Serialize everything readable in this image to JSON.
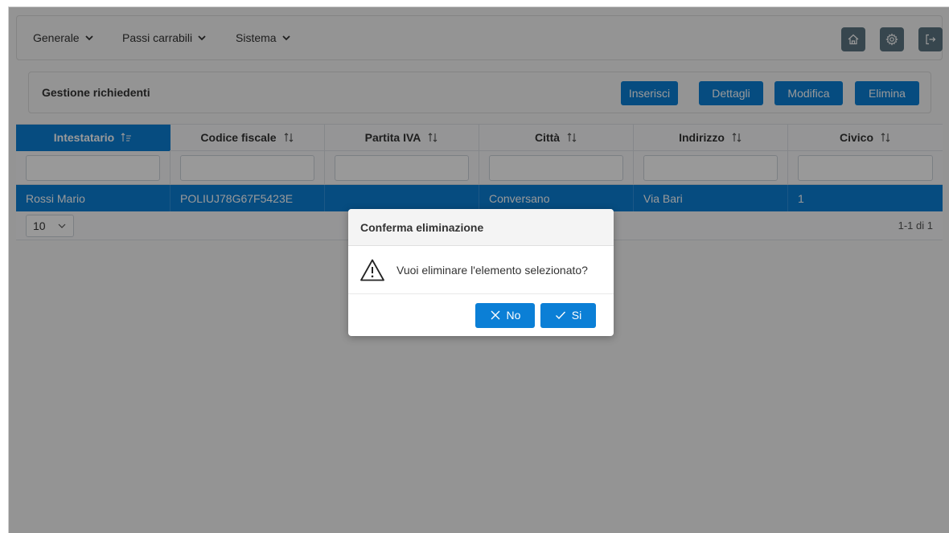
{
  "menubar": {
    "items": [
      {
        "label": "Generale"
      },
      {
        "label": "Passi carrabili"
      },
      {
        "label": "Sistema"
      }
    ],
    "icons": [
      "home-icon",
      "gear-icon",
      "logout-icon"
    ]
  },
  "toolbar": {
    "title": "Gestione richiedenti",
    "buttons": {
      "insert": "Inserisci",
      "details": "Dettagli",
      "edit": "Modifica",
      "delete": "Elimina"
    }
  },
  "table": {
    "columns": [
      {
        "label": "Intestatario",
        "sort": "ascending"
      },
      {
        "label": "Codice fiscale",
        "sort": "none"
      },
      {
        "label": "Partita IVA",
        "sort": "none"
      },
      {
        "label": "Città",
        "sort": "none"
      },
      {
        "label": "Indirizzo",
        "sort": "none"
      },
      {
        "label": "Civico",
        "sort": "none"
      }
    ],
    "rows": [
      {
        "intestatario": "Rossi Mario",
        "codice_fiscale": "POLIUJ78G67F5423E",
        "partita_iva": "",
        "citta": "Conversano",
        "indirizzo": "Via Bari",
        "civico": "1"
      }
    ],
    "paginator": {
      "rows_per_page": "10",
      "report": "1-1 di 1"
    }
  },
  "dialog": {
    "title": "Conferma eliminazione",
    "message": "Vuoi eliminare l'elemento selezionato?",
    "no_label": "No",
    "yes_label": "Si"
  },
  "colors": {
    "primary": "#0b7fd6",
    "icon_button": "#5d7582"
  }
}
